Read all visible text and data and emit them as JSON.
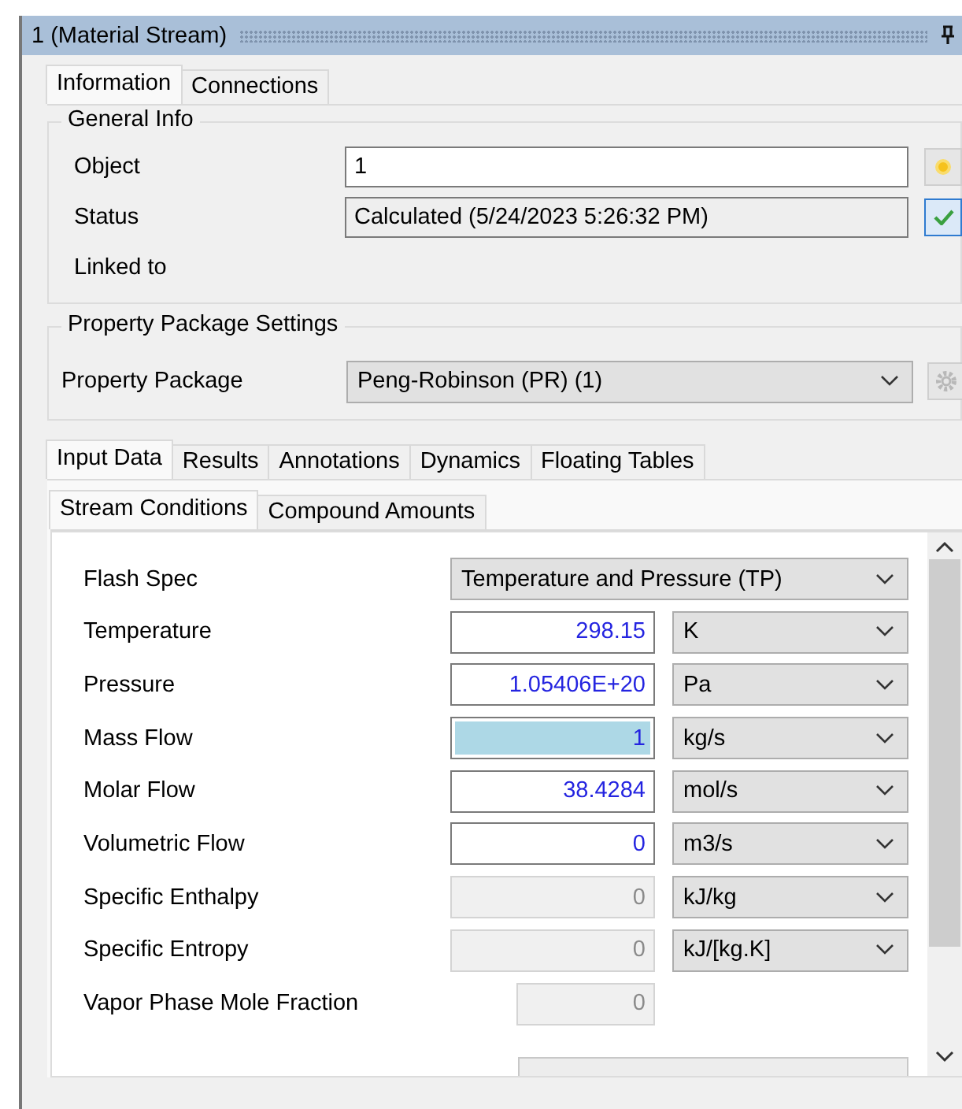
{
  "window": {
    "title": "1 (Material Stream)"
  },
  "top_tabs": [
    {
      "label": "Information",
      "selected": true
    },
    {
      "label": "Connections",
      "selected": false
    }
  ],
  "general_info": {
    "title": "General Info",
    "object": {
      "label": "Object",
      "value": "1"
    },
    "status": {
      "label": "Status",
      "value": "Calculated (5/24/2023 5:26:32 PM)",
      "calculated": true
    },
    "linked_to": {
      "label": "Linked to"
    }
  },
  "property_package_settings": {
    "title": "Property Package Settings",
    "label": "Property Package",
    "value": "Peng-Robinson (PR) (1)"
  },
  "data_tabs": [
    {
      "label": "Input Data",
      "selected": true
    },
    {
      "label": "Results",
      "selected": false
    },
    {
      "label": "Annotations",
      "selected": false
    },
    {
      "label": "Dynamics",
      "selected": false
    },
    {
      "label": "Floating Tables",
      "selected": false
    }
  ],
  "sub_tabs": [
    {
      "label": "Stream Conditions",
      "selected": true
    },
    {
      "label": "Compound Amounts",
      "selected": false
    }
  ],
  "fields": [
    {
      "kind": "combo",
      "label": "Flash Spec",
      "value": "Temperature and Pressure (TP)"
    },
    {
      "kind": "input",
      "label": "Temperature",
      "value": "298.15",
      "unit": "K",
      "selected": false
    },
    {
      "kind": "input",
      "label": "Pressure",
      "value": "1.05406E+20",
      "unit": "Pa",
      "selected": false
    },
    {
      "kind": "input",
      "label": "Mass Flow",
      "value": "1",
      "unit": "kg/s",
      "selected": true
    },
    {
      "kind": "input",
      "label": "Molar Flow",
      "value": "38.4284",
      "unit": "mol/s",
      "selected": false
    },
    {
      "kind": "input",
      "label": "Volumetric Flow",
      "value": "0",
      "unit": "m3/s",
      "selected": false
    },
    {
      "kind": "readonly",
      "label": "Specific Enthalpy",
      "value": "0",
      "unit": "kJ/kg"
    },
    {
      "kind": "readonly",
      "label": "Specific Entropy",
      "value": "0",
      "unit": "kJ/[kg.K]"
    },
    {
      "kind": "readonly_short",
      "label": "Vapor Phase Mole Fraction",
      "value": "0"
    }
  ]
}
